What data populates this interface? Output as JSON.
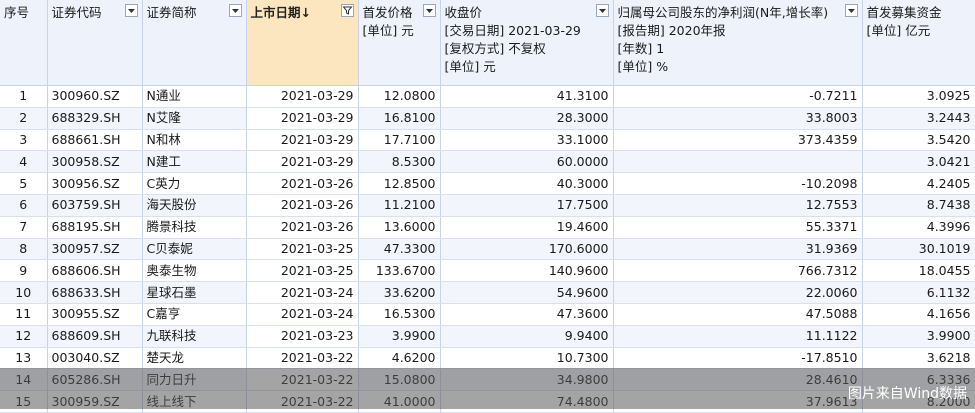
{
  "columns": [
    {
      "title": "序号",
      "sub": []
    },
    {
      "title": "证券代码",
      "sub": []
    },
    {
      "title": "证券简称",
      "sub": []
    },
    {
      "title": "上市日期↓",
      "sub": []
    },
    {
      "title": "首发价格",
      "sub": [
        "[单位] 元"
      ]
    },
    {
      "title": "收盘价",
      "sub": [
        "[交易日期] 2021-03-29",
        "[复权方式] 不复权",
        "[单位] 元"
      ]
    },
    {
      "title": "归属母公司股东的净利润(N年,增长率)",
      "sub": [
        "[报告期] 2020年报",
        "[年数] 1",
        "[单位] %"
      ]
    },
    {
      "title": "首发募集资金",
      "sub": [
        "[单位] 亿元"
      ]
    }
  ],
  "rows": [
    [
      "1",
      "300960.SZ",
      "N通业",
      "2021-03-29",
      "12.0800",
      "41.3100",
      "-0.7211",
      "3.0925"
    ],
    [
      "2",
      "688329.SH",
      "N艾隆",
      "2021-03-29",
      "16.8100",
      "28.3000",
      "33.8003",
      "3.2443"
    ],
    [
      "3",
      "688661.SH",
      "N和林",
      "2021-03-29",
      "17.7100",
      "33.1000",
      "373.4359",
      "3.5420"
    ],
    [
      "4",
      "300958.SZ",
      "N建工",
      "2021-03-29",
      "8.5300",
      "60.0000",
      "",
      "3.0421"
    ],
    [
      "5",
      "300956.SZ",
      "C英力",
      "2021-03-26",
      "12.8500",
      "40.3000",
      "-10.2098",
      "4.2405"
    ],
    [
      "6",
      "603759.SH",
      "海天股份",
      "2021-03-26",
      "11.2100",
      "17.7500",
      "12.7553",
      "8.7438"
    ],
    [
      "7",
      "688195.SH",
      "腾景科技",
      "2021-03-26",
      "13.6000",
      "19.4600",
      "55.3371",
      "4.3996"
    ],
    [
      "8",
      "300957.SZ",
      "C贝泰妮",
      "2021-03-25",
      "47.3300",
      "170.6000",
      "31.9369",
      "30.1019"
    ],
    [
      "9",
      "688606.SH",
      "奥泰生物",
      "2021-03-25",
      "133.6700",
      "140.9600",
      "766.7312",
      "18.0455"
    ],
    [
      "10",
      "688633.SH",
      "星球石墨",
      "2021-03-24",
      "33.6200",
      "54.9600",
      "22.0060",
      "6.1132"
    ],
    [
      "11",
      "300955.SZ",
      "C嘉亨",
      "2021-03-24",
      "16.5300",
      "47.3600",
      "47.5088",
      "4.1656"
    ],
    [
      "12",
      "688609.SH",
      "九联科技",
      "2021-03-23",
      "3.9900",
      "9.9400",
      "11.1122",
      "3.9900"
    ],
    [
      "13",
      "003040.SZ",
      "楚天龙",
      "2021-03-22",
      "4.6200",
      "10.7300",
      "-17.8510",
      "3.6218"
    ],
    [
      "14",
      "605286.SH",
      "同力日升",
      "2021-03-22",
      "15.0800",
      "34.9800",
      "28.4610",
      "6.3336"
    ],
    [
      "15",
      "300959.SZ",
      "线上线下",
      "2021-03-22",
      "41.0000",
      "74.4800",
      "37.9613",
      "8.2000"
    ]
  ],
  "watermark": "图片来自Wind数据"
}
